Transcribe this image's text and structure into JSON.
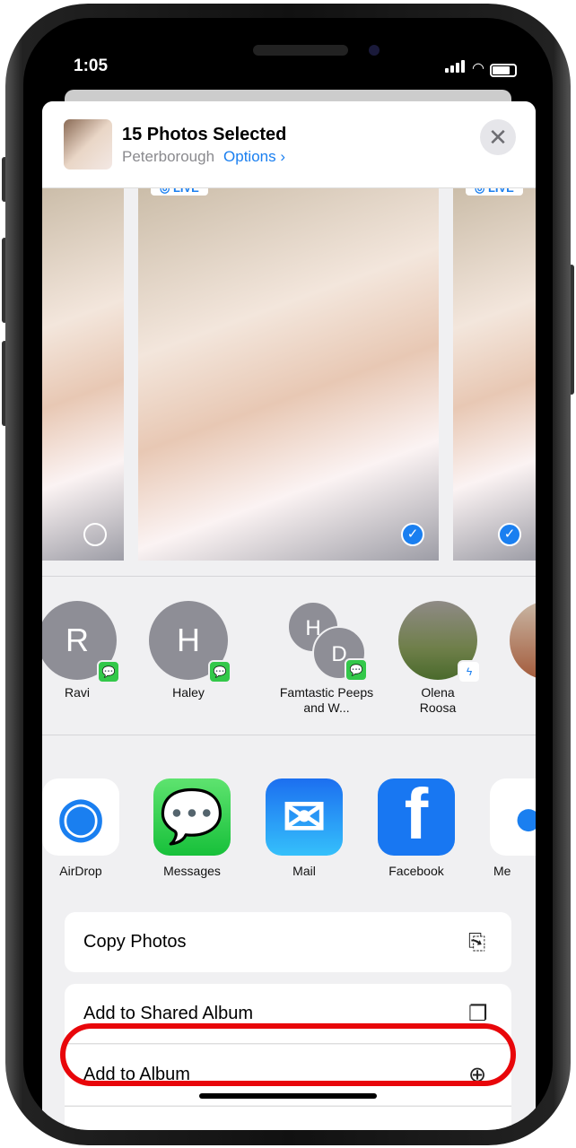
{
  "status": {
    "time": "1:05"
  },
  "header": {
    "title": "15 Photos Selected",
    "location": "Peterborough",
    "options_label": "Options ›",
    "close": "✕"
  },
  "photos": [
    {
      "selected": false,
      "live": ""
    },
    {
      "selected": true,
      "live": "◎ LIVE"
    },
    {
      "selected": true,
      "live": "◎ LIVE"
    }
  ],
  "people": [
    {
      "initial": "R",
      "name": "Ravi",
      "app": "messages"
    },
    {
      "initial": "H",
      "name": "Haley",
      "app": "messages"
    },
    {
      "initial": "H",
      "initial2": "D",
      "name": "Famtastic Peeps and W...",
      "app": "messages"
    },
    {
      "initial": "",
      "name": "Olena Roosa",
      "app": "messenger"
    }
  ],
  "apps": [
    {
      "name": "AirDrop",
      "color": "#ffffff"
    },
    {
      "name": "Messages",
      "color": "#2fcb47"
    },
    {
      "name": "Mail",
      "color": "#1e8cf4"
    },
    {
      "name": "Facebook",
      "color": "#1877f2"
    },
    {
      "name": "Me",
      "color": "#ffffff"
    }
  ],
  "actions": [
    {
      "label": "Copy Photos",
      "icon": "copy-icon"
    },
    {
      "label": "Add to Shared Album",
      "icon": "shared-album-icon"
    },
    {
      "label": "Add to Album",
      "icon": "add-album-icon"
    }
  ],
  "highlight_color": "#e8060a"
}
